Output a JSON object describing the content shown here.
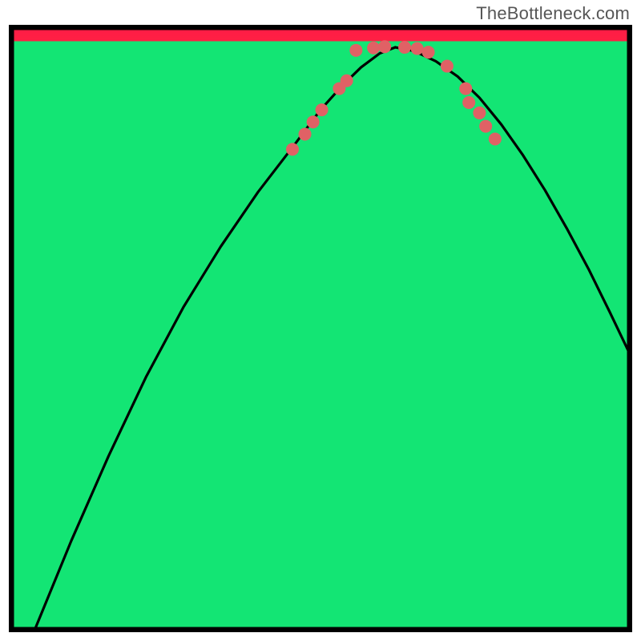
{
  "watermark": "TheBottleneck.com",
  "chart_data": {
    "type": "line",
    "title": "",
    "xlabel": "",
    "ylabel": "",
    "xlim": [
      0,
      100
    ],
    "ylim": [
      0,
      100
    ],
    "gradient_stops": [
      {
        "offset": 0,
        "color": "#ff1a46"
      },
      {
        "offset": 0.15,
        "color": "#ff3f3b"
      },
      {
        "offset": 0.35,
        "color": "#ff8a2a"
      },
      {
        "offset": 0.55,
        "color": "#ffd71f"
      },
      {
        "offset": 0.72,
        "color": "#fff31a"
      },
      {
        "offset": 0.85,
        "color": "#f7ff66"
      },
      {
        "offset": 0.93,
        "color": "#c6ff8e"
      },
      {
        "offset": 1.0,
        "color": "#17e87a"
      }
    ],
    "green_band": {
      "from": 97.3,
      "to": 100,
      "color": "#13e574"
    },
    "series": [
      {
        "name": "curve-left",
        "x": [
          4,
          10,
          16,
          22,
          28,
          34,
          40,
          46,
          50,
          53.5,
          56.5,
          59.5,
          62
        ],
        "y": [
          0,
          15,
          29,
          42,
          53.5,
          63.5,
          72.5,
          80.5,
          86,
          90,
          93,
          95.3,
          96.3
        ]
      },
      {
        "name": "curve-right",
        "x": [
          62,
          65,
          68.5,
          72,
          75.5,
          79,
          82.5,
          86,
          89.5,
          93,
          96.5,
          100
        ],
        "y": [
          96.3,
          95.7,
          94,
          91.5,
          88,
          83.6,
          78.5,
          72.8,
          66.5,
          59.8,
          52.5,
          45
        ]
      }
    ],
    "markers": {
      "color": "#e06165",
      "radius": 8,
      "points": [
        {
          "x": 45.5,
          "y": 79.5
        },
        {
          "x": 47.5,
          "y": 82
        },
        {
          "x": 48.8,
          "y": 84
        },
        {
          "x": 50.2,
          "y": 86
        },
        {
          "x": 53.0,
          "y": 89.5
        },
        {
          "x": 54.2,
          "y": 90.8
        },
        {
          "x": 55.7,
          "y": 95.8
        },
        {
          "x": 58.5,
          "y": 96.2
        },
        {
          "x": 60.3,
          "y": 96.4
        },
        {
          "x": 63.5,
          "y": 96.3
        },
        {
          "x": 65.5,
          "y": 96.1
        },
        {
          "x": 67.3,
          "y": 95.5
        },
        {
          "x": 70.3,
          "y": 93.2
        },
        {
          "x": 73.3,
          "y": 89.5
        },
        {
          "x": 73.8,
          "y": 87.2
        },
        {
          "x": 75.5,
          "y": 85.5
        },
        {
          "x": 76.5,
          "y": 83.3
        },
        {
          "x": 78.0,
          "y": 81.2
        }
      ]
    }
  }
}
